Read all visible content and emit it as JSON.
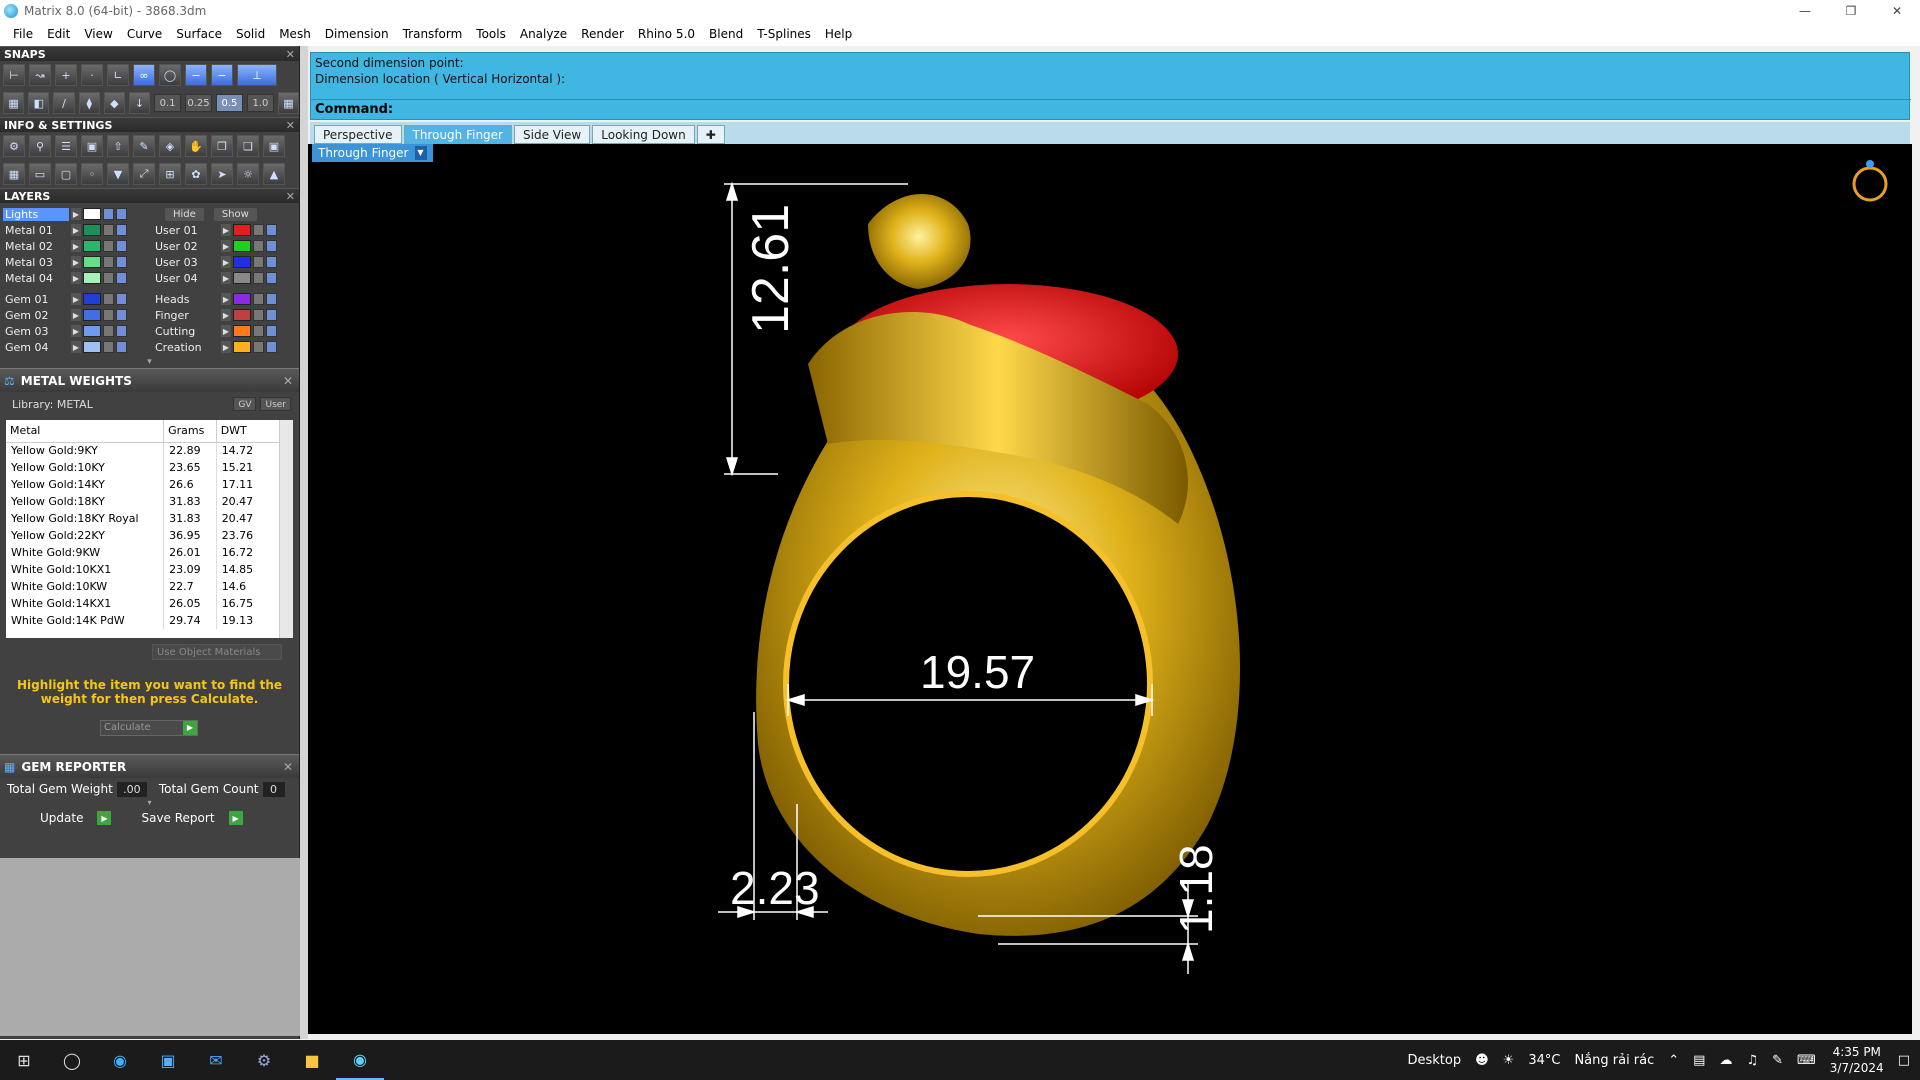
{
  "window": {
    "title": "Matrix 8.0 (64-bit) - 3868.3dm"
  },
  "menu": [
    "File",
    "Edit",
    "View",
    "Curve",
    "Surface",
    "Solid",
    "Mesh",
    "Dimension",
    "Transform",
    "Tools",
    "Analyze",
    "Render",
    "Rhino 5.0",
    "Blend",
    "T-Splines",
    "Help"
  ],
  "snaps": {
    "title": "SNAPS",
    "steps": [
      "0.1",
      "0.25",
      "0.5",
      "1.0"
    ]
  },
  "info": {
    "title": "INFO & SETTINGS"
  },
  "layers": {
    "title": "LAYERS",
    "hide_label": "Hide",
    "show_label": "Show",
    "left": [
      {
        "name": "Lights",
        "color": "#ffffff"
      },
      {
        "name": "Metal 01",
        "color": "#1e8f5a"
      },
      {
        "name": "Metal 02",
        "color": "#2db36b"
      },
      {
        "name": "Metal 03",
        "color": "#66dd88"
      },
      {
        "name": "Metal 04",
        "color": "#a8f0b8"
      },
      {
        "name": "Gem 01",
        "color": "#1f3fd6"
      },
      {
        "name": "Gem 02",
        "color": "#3f6fe0"
      },
      {
        "name": "Gem 03",
        "color": "#6f9bef"
      },
      {
        "name": "Gem 04",
        "color": "#9fc0f5"
      }
    ],
    "right": [
      {
        "name": "User 01",
        "color": "#e02020"
      },
      {
        "name": "User 02",
        "color": "#20d020"
      },
      {
        "name": "User 03",
        "color": "#2030e0"
      },
      {
        "name": "User 04",
        "color": "#888888"
      },
      {
        "name": "Heads",
        "color": "#8a2be2"
      },
      {
        "name": "Finger",
        "color": "#c04040"
      },
      {
        "name": "Cutting",
        "color": "#ff7a1a"
      },
      {
        "name": "Creation",
        "color": "#ffb020"
      }
    ]
  },
  "metal_weights": {
    "title": "METAL WEIGHTS",
    "library": "Library: METAL",
    "gv_label": "GV",
    "user_label": "User",
    "columns": [
      "Metal",
      "Grams",
      "DWT"
    ],
    "rows": [
      [
        "Yellow Gold:9KY",
        "22.89",
        "14.72"
      ],
      [
        "Yellow Gold:10KY",
        "23.65",
        "15.21"
      ],
      [
        "Yellow Gold:14KY",
        "26.6",
        "17.11"
      ],
      [
        "Yellow Gold:18KY",
        "31.83",
        "20.47"
      ],
      [
        "Yellow Gold:18KY Royal",
        "31.83",
        "20.47"
      ],
      [
        "Yellow Gold:22KY",
        "36.95",
        "23.76"
      ],
      [
        "White Gold:9KW",
        "26.01",
        "16.72"
      ],
      [
        "White Gold:10KX1",
        "23.09",
        "14.85"
      ],
      [
        "White Gold:10KW",
        "22.7",
        "14.6"
      ],
      [
        "White Gold:14KX1",
        "26.05",
        "16.75"
      ],
      [
        "White Gold:14K PdW",
        "29.74",
        "19.13"
      ]
    ],
    "use_object_materials": "Use Object Materials",
    "hint": "Highlight the item you want to find the weight for then press Calculate.",
    "calculate_label": "Calculate"
  },
  "gem_reporter": {
    "title": "GEM REPORTER",
    "total_weight_label": "Total Gem Weight",
    "total_weight_value": ".00",
    "total_count_label": "Total Gem Count",
    "total_count_value": "0",
    "update_label": "Update",
    "save_label": "Save Report"
  },
  "command": {
    "history": [
      "Second dimension point:",
      "Dimension location ( Vertical  Horizontal ):"
    ],
    "prompt": "Command:"
  },
  "tabs": [
    "Perspective",
    "Through Finger",
    "Side View",
    "Looking Down"
  ],
  "active_tab": "Through Finger",
  "viewport": {
    "label": "Through Finger",
    "dimensions": {
      "height": "12.61",
      "inner": "19.57",
      "left_width": "2.23",
      "bottom": "1.18"
    }
  },
  "taskbar": {
    "desktop_label": "Desktop",
    "temperature": "34°C",
    "weather": "Nắng rải rác",
    "time": "4:35 PM",
    "date": "3/7/2024"
  }
}
